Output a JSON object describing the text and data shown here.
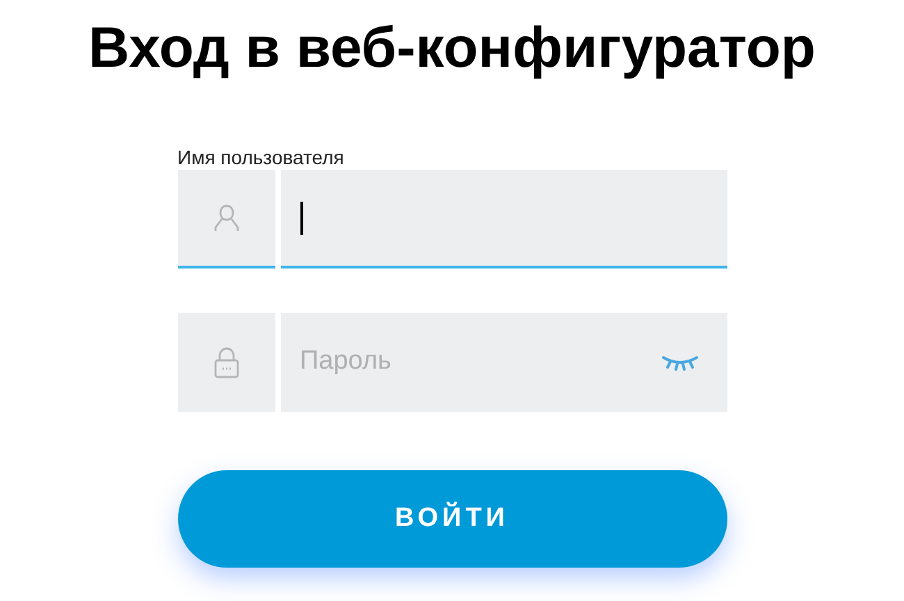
{
  "title": "Вход в веб-конфигуратор",
  "username": {
    "label": "Имя пользователя",
    "focused": true
  },
  "password": {
    "placeholder": "Пароль"
  },
  "submit_button": "ВОЙТИ"
}
